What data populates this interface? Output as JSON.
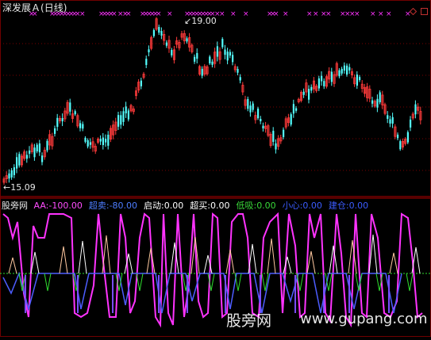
{
  "main_header": {
    "stock_name": "深发展Ａ",
    "period": "(日线)"
  },
  "price_labels": {
    "high": "19.00",
    "low": "15.09"
  },
  "indicator_header": {
    "name": "股旁网",
    "items": [
      {
        "label": "AA:",
        "value": "-100.00",
        "color": "#ff4dff"
      },
      {
        "label": "超卖:",
        "value": "-80.00",
        "color": "#4d7dff"
      },
      {
        "label": "启动:",
        "value": "0.00",
        "color": "#ffffff"
      },
      {
        "label": "超买:",
        "value": "0.00",
        "color": "#ffffff"
      },
      {
        "label": "低吸:",
        "value": "0.00",
        "color": "#39d839"
      },
      {
        "label": "小心:",
        "value": "0.00",
        "color": "#3b5cff"
      },
      {
        "label": "建仓:",
        "value": "0.00",
        "color": "#3b5cff"
      }
    ]
  },
  "watermark": {
    "text": "股旁网",
    "url": "www.gupang.com"
  },
  "colors": {
    "up": "#ff3b3b",
    "down": "#54ffff",
    "magenta": "#ff33ff",
    "blue": "#4d5dff",
    "green": "#2edc2e",
    "white": "#ffffff",
    "panel_bg": "#000000",
    "grid": "#7a0000"
  }
}
